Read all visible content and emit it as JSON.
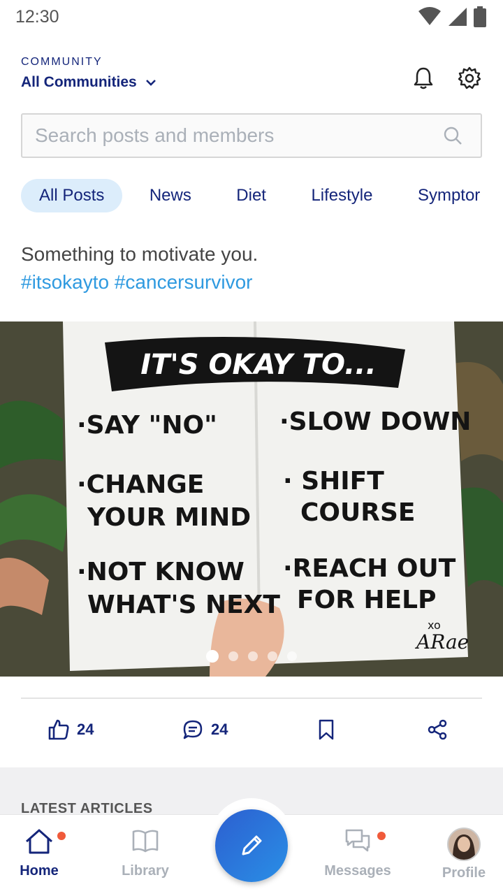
{
  "status_bar": {
    "time": "12:30"
  },
  "header": {
    "label": "COMMUNITY",
    "title": "All Communities"
  },
  "search": {
    "placeholder": "Search posts and members"
  },
  "tabs": [
    {
      "label": "All Posts",
      "active": true
    },
    {
      "label": "News"
    },
    {
      "label": "Diet"
    },
    {
      "label": "Lifestyle"
    },
    {
      "label": "Symptor"
    }
  ],
  "post": {
    "text": "Something to motivate you.",
    "hashtags": "#itsokayto #cancersurvivor",
    "image": {
      "title": "IT'S OKAY TO...",
      "left_items": [
        "·SAY \"NO\"",
        "·CHANGE",
        "YOUR MIND",
        "·NOT KNOW",
        "WHAT'S NEXT"
      ],
      "right_items": [
        "·SLOW DOWN",
        "· SHIFT",
        "COURSE",
        "·REACH OUT",
        "FOR HELP"
      ],
      "signature_top": "xo",
      "signature": "ARae",
      "slide_count": 5,
      "active_slide": 1
    },
    "likes": "24",
    "comments": "24"
  },
  "section": {
    "title": "LATEST ARTICLES"
  },
  "nav": {
    "home": "Home",
    "library": "Library",
    "messages": "Messages",
    "profile": "Profile"
  },
  "colors": {
    "brand": "#14257a",
    "accent": "#2f9ae0",
    "badge": "#f05a3a"
  }
}
